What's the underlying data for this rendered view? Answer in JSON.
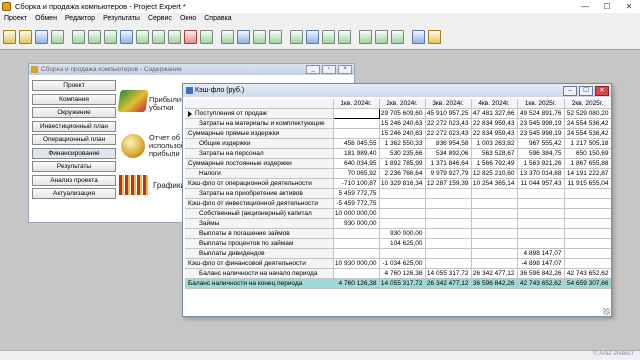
{
  "app": {
    "title": "Сборка и продажа компьютеров - Project Expert *"
  },
  "window_controls": {
    "minimize": "—",
    "maximize": "☐",
    "close": "✕"
  },
  "menu": [
    "Проект",
    "Обмен",
    "Редактор",
    "Результаты",
    "Сервис",
    "Окно",
    "Справка"
  ],
  "content_window": {
    "title": "Сборка и продажа компьютеров - Содержание",
    "nav": [
      "Проект",
      "Компания",
      "Окружение",
      "Инвестиционный план",
      "Операционный план",
      "Финансирование",
      "Результаты",
      "Анализ проекта",
      "Актуализация"
    ],
    "label_profit": "Прибыли-\nубытки",
    "label_report": "Отчет об\nиспользовании\nприбыли",
    "label_charts": "Графики"
  },
  "cashflow_window": {
    "title": "Кэш-фло (руб.)",
    "columns": [
      "1кв. 2024г.",
      "2кв. 2024г.",
      "3кв. 2024г.",
      "4кв. 2024г.",
      "1кв. 2025г.",
      "2кв. 2025г."
    ],
    "rows": [
      {
        "label": "Поступления от продаж",
        "indent": false,
        "pointer": true,
        "values": [
          "",
          "29 705 609,60",
          "45 910 957,25",
          "47 481 327,66",
          "49 524 891,76",
          "52 529 080,20"
        ]
      },
      {
        "label": "Затраты на материалы и комплектующие",
        "indent": true,
        "values": [
          "",
          "15 246 240,63",
          "22 272 023,43",
          "22 834 959,43",
          "23 545 998,19",
          "24 554 536,42"
        ]
      },
      {
        "label": "Суммарные прямые издержки",
        "indent": false,
        "values": [
          "",
          "15 246 240,63",
          "22 272 023,43",
          "22 834 959,43",
          "23 545 998,19",
          "24 554 536,42"
        ]
      },
      {
        "label": "Общие издержки",
        "indent": true,
        "values": [
          "458 045,55",
          "1 362 550,33",
          "836 954,58",
          "1 003 263,82",
          "967 555,42",
          "1 217 505,18"
        ]
      },
      {
        "label": "Затраты на персонал",
        "indent": true,
        "values": [
          "181 989,40",
          "530 235,66",
          "534 892,06",
          "563 528,67",
          "596 384,75",
          "650 150,69"
        ]
      },
      {
        "label": "Суммарные постоянные издержки",
        "indent": false,
        "values": [
          "640 034,95",
          "1 892 785,99",
          "1 371 846,64",
          "1 566 792,49",
          "1 563 921,26",
          "1 867 655,88"
        ]
      },
      {
        "label": "Налоги",
        "indent": true,
        "values": [
          "70 065,92",
          "2 236 766,64",
          "9 979 927,79",
          "12 825 210,60",
          "13 370 014,88",
          "14 191 222,87"
        ]
      },
      {
        "label": "Кэш-фло от операционной деятельности",
        "indent": false,
        "values": [
          "-710 100,87",
          "10 329 816,34",
          "12 287 159,39",
          "10 254 365,14",
          "11 044 957,43",
          "11 915 655,04"
        ]
      },
      {
        "label": "Затраты на приобретение активов",
        "indent": true,
        "values": [
          "5 459 772,75",
          "",
          "",
          "",
          "",
          ""
        ]
      },
      {
        "label": "Кэш-фло от инвестиционной деятельности",
        "indent": false,
        "values": [
          "-5 459 772,75",
          "",
          "",
          "",
          "",
          ""
        ]
      },
      {
        "label": "Собственный (акционерный) капитал",
        "indent": true,
        "values": [
          "10 000 000,00",
          "",
          "",
          "",
          "",
          ""
        ]
      },
      {
        "label": "Займы",
        "indent": true,
        "values": [
          "930 000,00",
          "",
          "",
          "",
          "",
          ""
        ]
      },
      {
        "label": "Выплаты в погашение займов",
        "indent": true,
        "values": [
          "",
          "930 000,00",
          "",
          "",
          "",
          ""
        ]
      },
      {
        "label": "Выплаты процентов по займам",
        "indent": true,
        "values": [
          "",
          "104 625,00",
          "",
          "",
          "",
          ""
        ]
      },
      {
        "label": "Выплаты дивидендов",
        "indent": true,
        "values": [
          "",
          "",
          "",
          "",
          "4 898 147,07",
          ""
        ]
      },
      {
        "label": "Кэш-фло от финансовой деятельности",
        "indent": false,
        "values": [
          "10 930 000,00",
          "-1 034 625,00",
          "",
          "",
          "-4 898 147,07",
          ""
        ]
      },
      {
        "label": "Баланс наличности на начало периода",
        "indent": true,
        "values": [
          "",
          "4 760 126,38",
          "14 055 317,72",
          "26 342 477,12",
          "36 596 842,26",
          "42 743 652,62"
        ]
      },
      {
        "label": "Баланс наличности на конец периода",
        "indent": false,
        "final": true,
        "values": [
          "4 760 126,38",
          "14 055 317,72",
          "26 342 477,12",
          "36 596 842,26",
          "42 743 652,62",
          "54 659 307,66"
        ]
      }
    ]
  },
  "watermark": "© Альт-Инвест"
}
